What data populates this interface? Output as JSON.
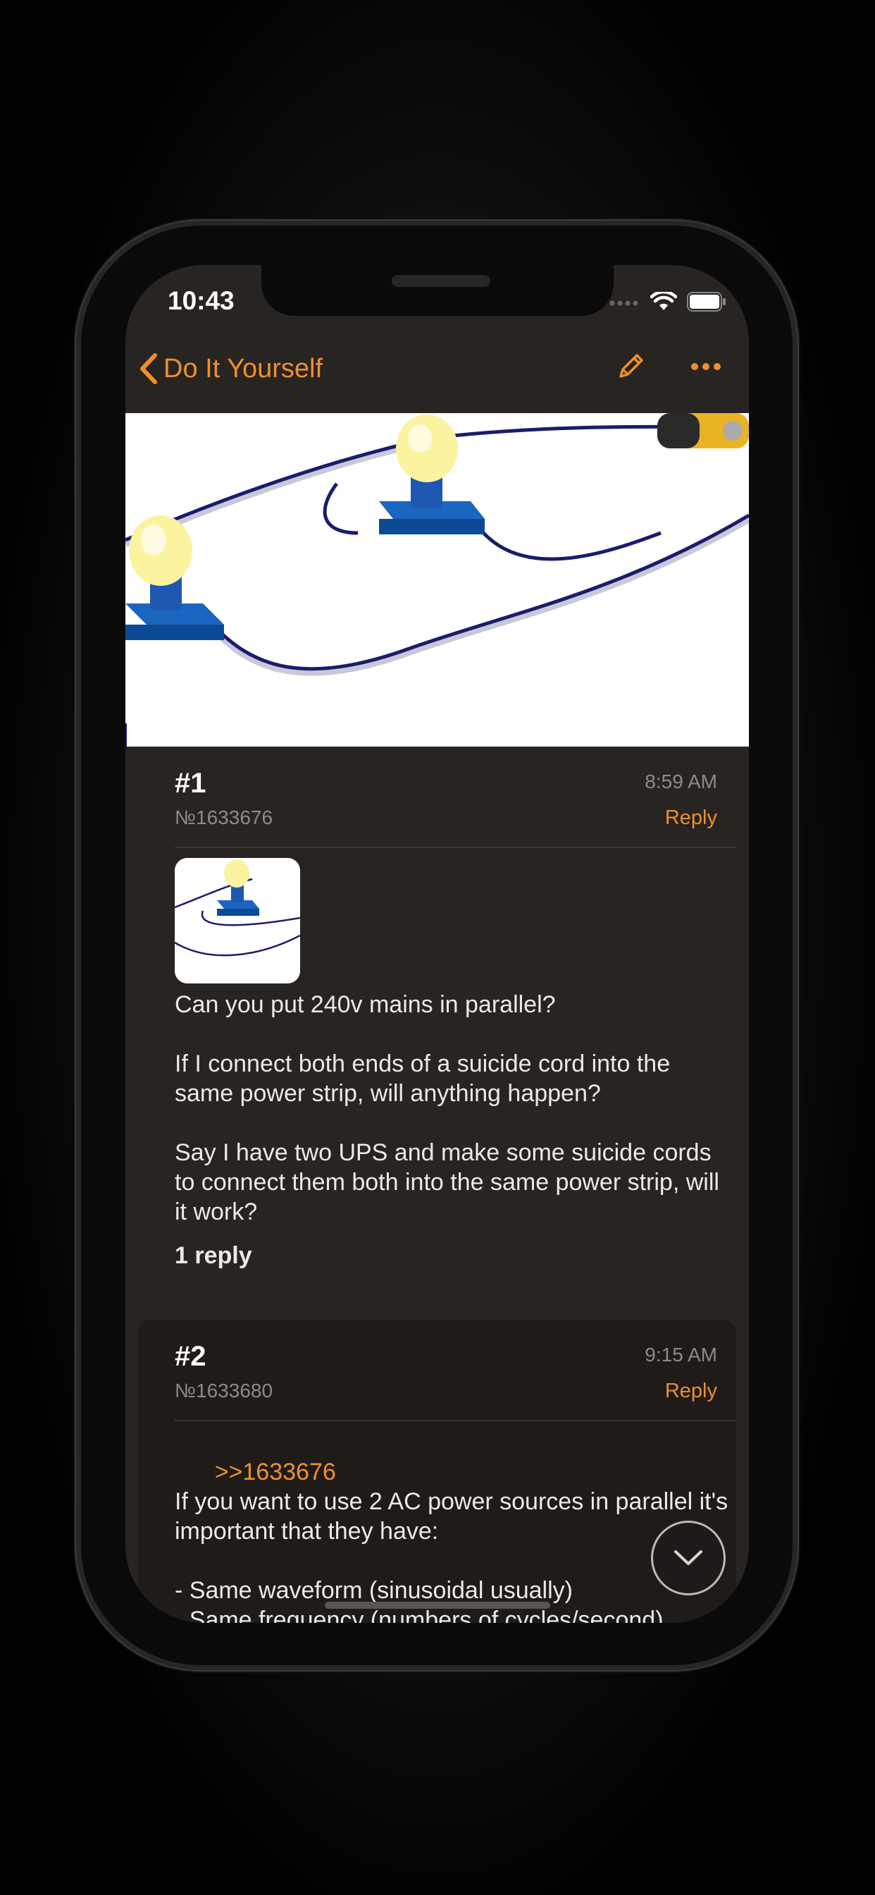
{
  "status_bar": {
    "time": "10:43"
  },
  "nav": {
    "back_label": "Do It Yourself",
    "compose_icon": "pencil-icon",
    "more_icon": "ellipsis-icon"
  },
  "posts": [
    {
      "number": "#1",
      "id": "№1633676",
      "time": "8:59 AM",
      "reply_label": "Reply",
      "body": "Can you put 240v mains in parallel?\n\nIf I connect both ends of a suicide cord into the same power strip, will anything happen?\n\nSay I have two UPS and make some suicide cords to connect them both into the same power strip, will it work?",
      "replies": "1 reply"
    },
    {
      "number": "#2",
      "id": "№1633680",
      "time": "9:15 AM",
      "reply_label": "Reply",
      "quote": ">>1633676",
      "body": "If you want to use 2 AC power sources in parallel it's important that they have:\n\n- Same waveform (sinusoidal usually)\n- Same frequency (numbers of cycles/second)\n- Same amplitude (top voltage value of the"
    }
  ],
  "colors": {
    "accent": "#f0902c",
    "background": "#272422",
    "card": "#1e1b19"
  }
}
